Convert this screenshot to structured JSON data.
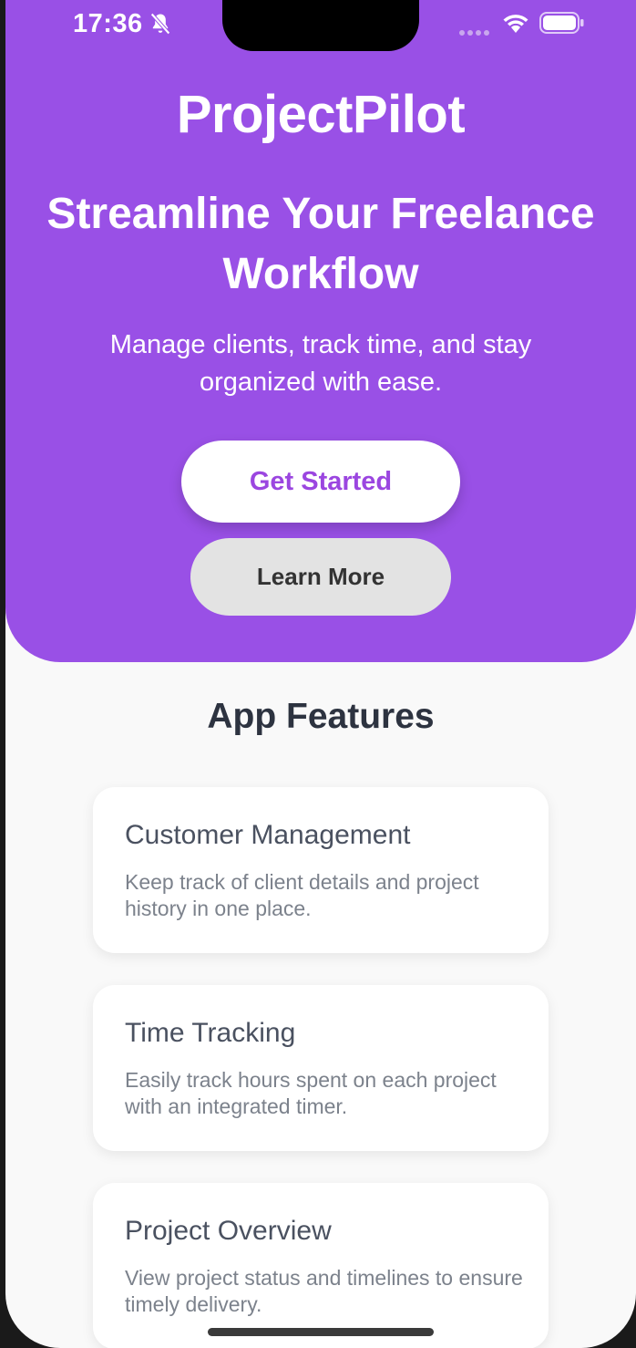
{
  "status_bar": {
    "time": "17:36",
    "icons": [
      "bell-slash-icon",
      "signal-dots-icon",
      "wifi-icon",
      "battery-icon"
    ]
  },
  "hero": {
    "app_name": "ProjectPilot",
    "headline": "Streamline Your Freelance Workflow",
    "subheadline": "Manage clients, track time, and stay organized with ease.",
    "primary_button": "Get Started",
    "secondary_button": "Learn More",
    "background_color": "#9950e6"
  },
  "features": {
    "title": "App Features",
    "items": [
      {
        "title": "Customer Management",
        "description": "Keep track of client details and project history in one place."
      },
      {
        "title": "Time Tracking",
        "description": "Easily track hours spent on each project with an integrated timer."
      },
      {
        "title": "Project Overview",
        "description": "View project status and timelines to ensure timely delivery."
      }
    ]
  }
}
